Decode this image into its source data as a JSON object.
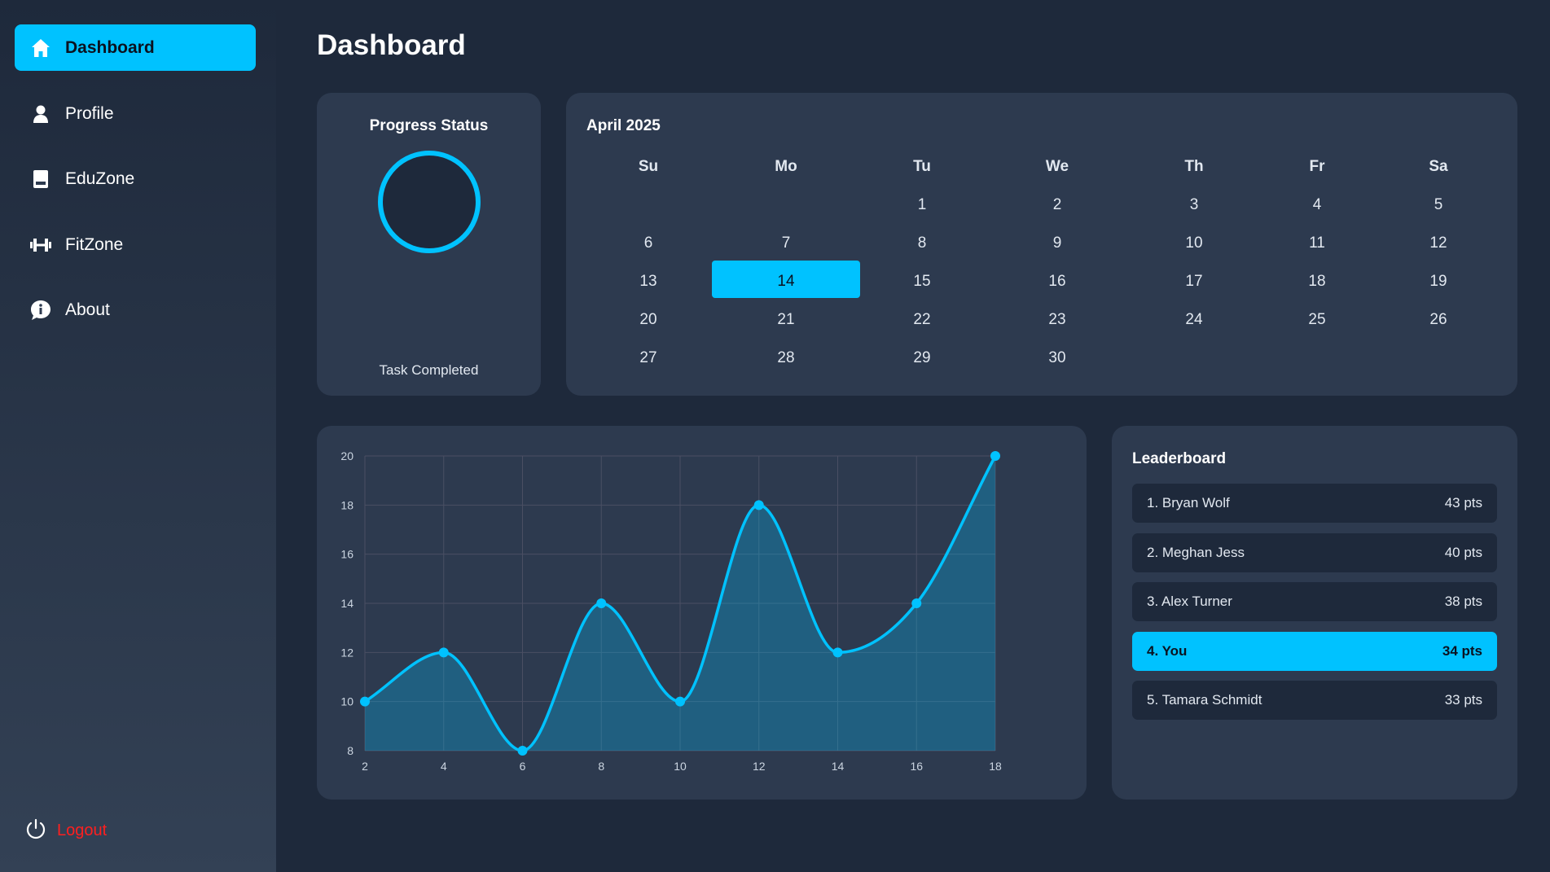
{
  "sidebar": {
    "items": [
      {
        "label": "Dashboard",
        "icon": "home-icon",
        "active": true
      },
      {
        "label": "Profile",
        "icon": "user-icon"
      },
      {
        "label": "EduZone",
        "icon": "book-icon"
      },
      {
        "label": "FitZone",
        "icon": "dumbbell-icon"
      },
      {
        "label": "About",
        "icon": "info-icon"
      }
    ],
    "logout_label": "Logout"
  },
  "page_title": "Dashboard",
  "progress": {
    "title": "Progress Status",
    "caption": "Task Completed"
  },
  "calendar": {
    "title": "April 2025",
    "weekdays": [
      "Su",
      "Mo",
      "Tu",
      "We",
      "Th",
      "Fr",
      "Sa"
    ],
    "weeks": [
      [
        "",
        "",
        "1",
        "2",
        "3",
        "4",
        "5"
      ],
      [
        "6",
        "7",
        "8",
        "9",
        "10",
        "11",
        "12"
      ],
      [
        "13",
        "14",
        "15",
        "16",
        "17",
        "18",
        "19"
      ],
      [
        "20",
        "21",
        "22",
        "23",
        "24",
        "25",
        "26"
      ],
      [
        "27",
        "28",
        "29",
        "30",
        "",
        "",
        ""
      ]
    ],
    "selected_day": "14"
  },
  "leaderboard": {
    "title": "Leaderboard",
    "rows": [
      {
        "name": "1. Bryan Wolf",
        "points": "43 pts"
      },
      {
        "name": "2. Meghan Jess",
        "points": "40 pts"
      },
      {
        "name": "3. Alex Turner",
        "points": "38 pts"
      },
      {
        "name": "4. You",
        "points": "34 pts",
        "highlight": true
      },
      {
        "name": "5. Tamara Schmidt",
        "points": "33 pts"
      }
    ]
  },
  "colors": {
    "accent": "#00c2ff",
    "background": "#1e293b",
    "card": "#2d3a4f",
    "logout": "#ff1f1f"
  },
  "chart_data": {
    "type": "area",
    "x": [
      2,
      4,
      6,
      8,
      10,
      12,
      14,
      16,
      18
    ],
    "series": [
      {
        "values": [
          10,
          12,
          8,
          14,
          10,
          18,
          12,
          14,
          20
        ]
      }
    ],
    "xlim": [
      2,
      18
    ],
    "ylim": [
      8,
      20
    ],
    "xticks": [
      2,
      4,
      6,
      8,
      10,
      12,
      14,
      16,
      18
    ],
    "yticks": [
      8,
      10,
      12,
      14,
      16,
      18,
      20
    ],
    "grid": true,
    "color": "#00c2ff"
  }
}
